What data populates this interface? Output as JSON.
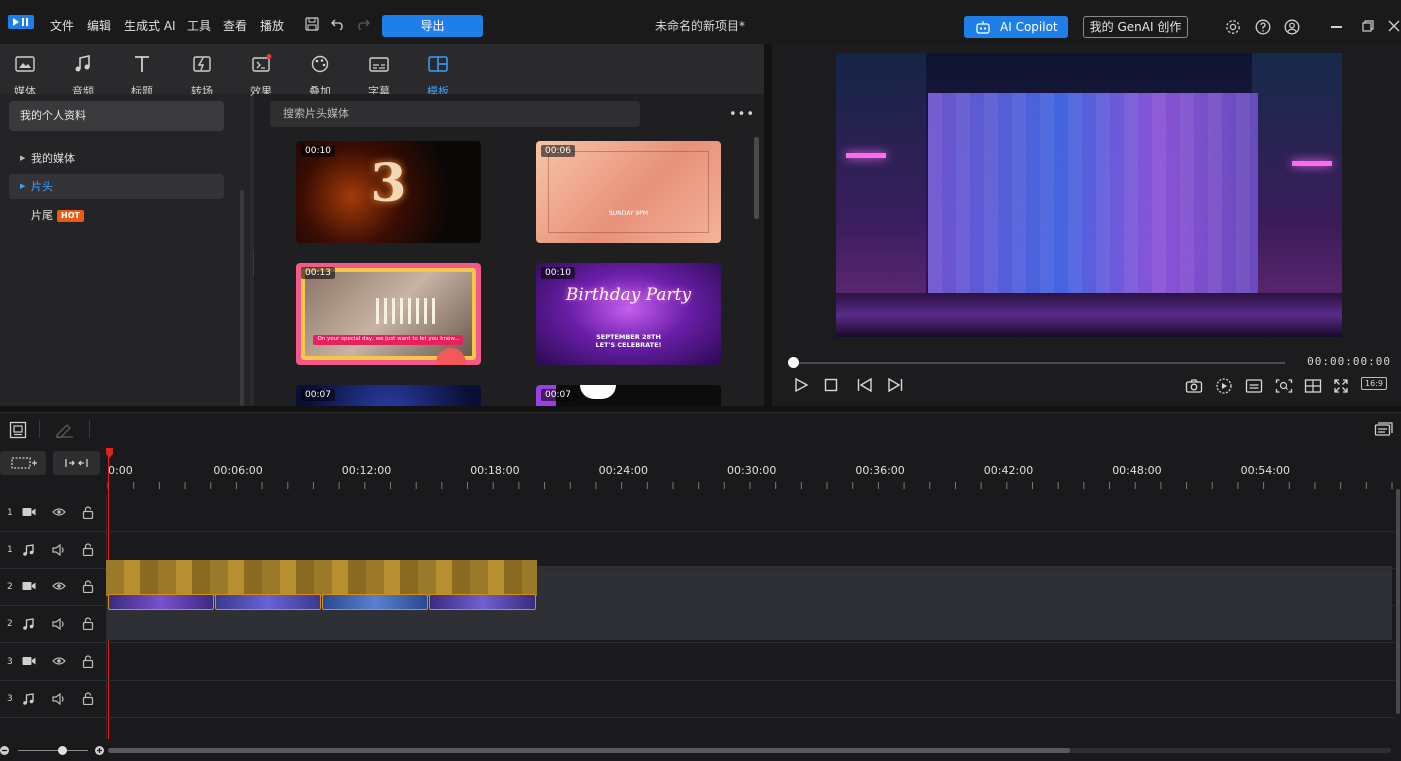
{
  "menubar": {
    "items": [
      "文件",
      "编辑",
      "生成式 AI",
      "工具",
      "查看",
      "播放"
    ],
    "export_label": "导出",
    "project_title": "未命名的新项目*",
    "copilot_label": "AI Copilot",
    "genai_label": "我的 GenAI 创作"
  },
  "tool_tabs": [
    {
      "label": "媒体"
    },
    {
      "label": "音频"
    },
    {
      "label": "标题"
    },
    {
      "label": "转场"
    },
    {
      "label": "效果"
    },
    {
      "label": "叠加"
    },
    {
      "label": "字幕"
    },
    {
      "label": "模板"
    }
  ],
  "left_nav": {
    "profile_label": "我的个人资料",
    "items": [
      {
        "label": "我的媒体"
      },
      {
        "label": "片头"
      },
      {
        "label": "片尾"
      }
    ],
    "hot_badge": "HOT"
  },
  "content": {
    "search_placeholder": "搜索片头媒体",
    "thumbs": [
      {
        "duration": "00:10",
        "text": "3"
      },
      {
        "duration": "00:06",
        "text": "SUNDAY 9PM"
      },
      {
        "duration": "00:13",
        "text": "On your special day, we just want to let you know..."
      },
      {
        "duration": "00:10",
        "text": "Birthday Party",
        "sub": "SEPTEMBER 28TH\nLET'S CELEBRATE!"
      },
      {
        "duration": "00:07"
      },
      {
        "duration": "00:07"
      }
    ]
  },
  "preview": {
    "timecode": "00:00:00:00",
    "ratio": "16:9",
    "progress": 0
  },
  "timeline": {
    "ticks": [
      "0:00",
      "00:06:00",
      "00:12:00",
      "00:18:00",
      "00:24:00",
      "00:30:00",
      "00:36:00",
      "00:42:00",
      "00:48:00",
      "00:54:00"
    ],
    "tracks": [
      {
        "num": "1",
        "type": "video"
      },
      {
        "num": "1",
        "type": "audio"
      },
      {
        "num": "2",
        "type": "video"
      },
      {
        "num": "2",
        "type": "audio"
      },
      {
        "num": "3",
        "type": "video"
      },
      {
        "num": "3",
        "type": "audio"
      }
    ]
  },
  "colors": {
    "accent": "#1f7fe8",
    "hot": "#ea5b16",
    "clip_border": "#d58e18"
  }
}
